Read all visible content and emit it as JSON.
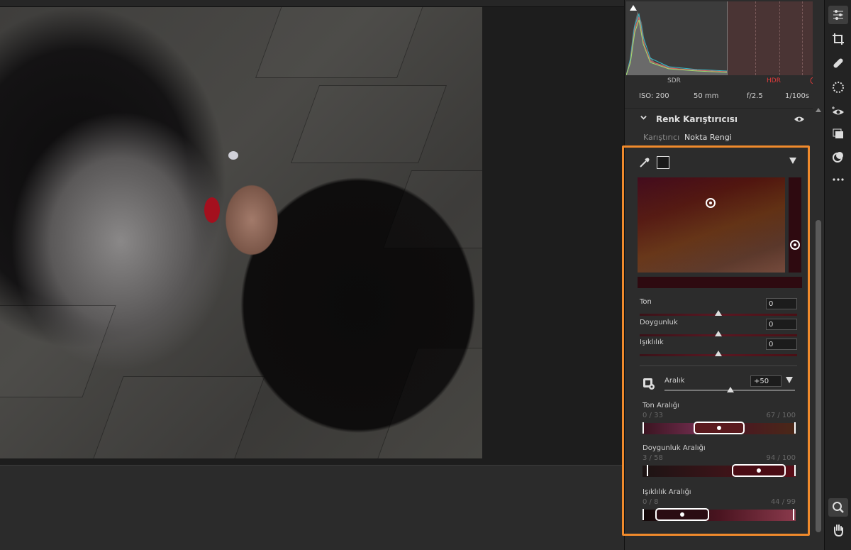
{
  "histogram": {
    "sdr_label": "SDR",
    "hdr_label": "HDR",
    "colors": {
      "sdr_zone": "#3c3c3c",
      "hdr_zone": "#4a3434",
      "hdr_text": "#e23b3b"
    }
  },
  "exif": {
    "iso": "ISO: 200",
    "focal": "50 mm",
    "aperture": "f/2.5",
    "shutter": "1/100s"
  },
  "section": {
    "title": "Renk Karıştırıcısı",
    "tabs": [
      "Karıştırıcı",
      "Nokta Rengi"
    ],
    "active_tab": "Nokta Rengi"
  },
  "sliders": [
    {
      "label": "Ton",
      "value": "0"
    },
    {
      "label": "Doygunluk",
      "value": "0"
    },
    {
      "label": "Işıklılık",
      "value": "0"
    }
  ],
  "aralik": {
    "label": "Aralık",
    "value": "+50"
  },
  "ranges": [
    {
      "title": "Ton Aralığı",
      "left": "0 / 33",
      "right": "67 / 100"
    },
    {
      "title": "Doygunluk Aralığı",
      "left": "3 / 58",
      "right": "94 / 100"
    },
    {
      "title": "Işıklılık Aralığı",
      "left": "0 / 8",
      "right": "44 / 99"
    }
  ],
  "accent": "#f08a2c"
}
